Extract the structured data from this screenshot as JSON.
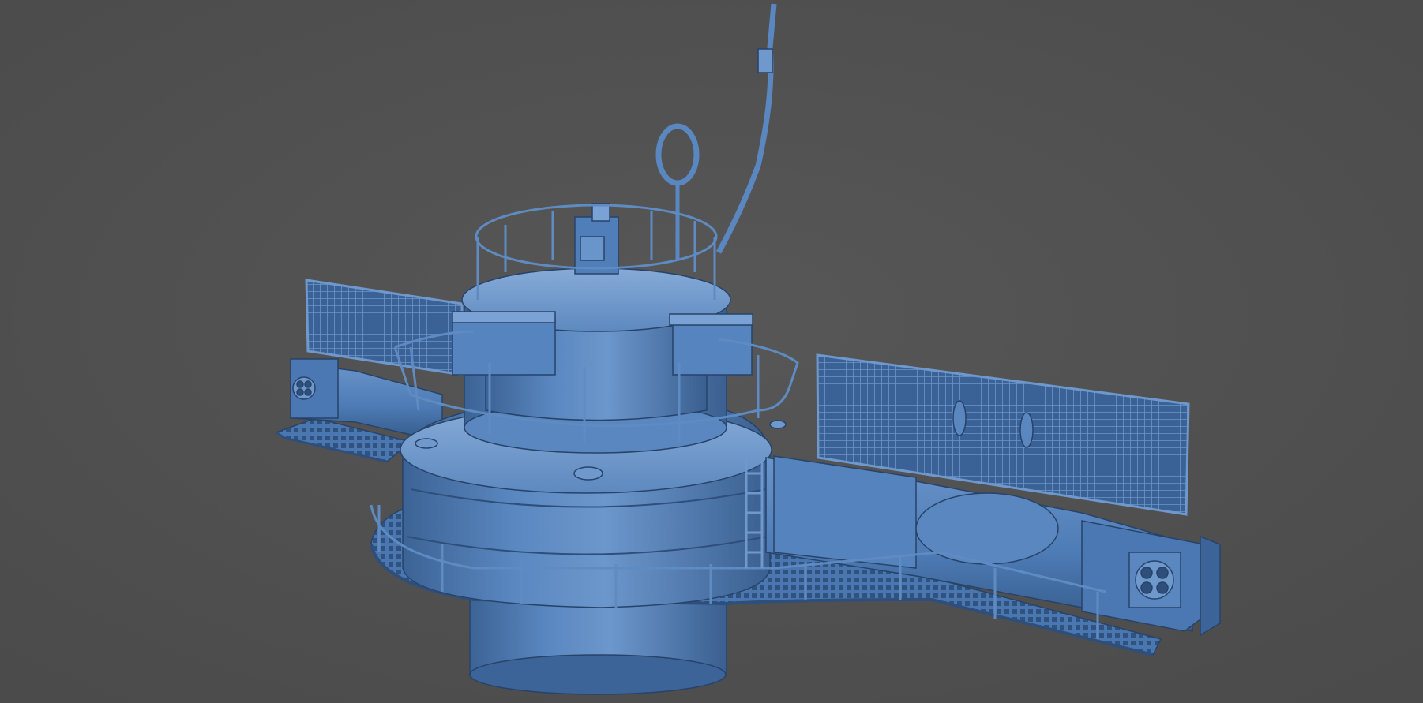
{
  "viewport": {
    "background": "#4f4f4f",
    "background_center": "#575757"
  },
  "model": {
    "base_color": "#4d7bb5",
    "light_color": "#7ea6d6",
    "dark_color": "#2e4f7c",
    "line_color": "#27436a"
  }
}
